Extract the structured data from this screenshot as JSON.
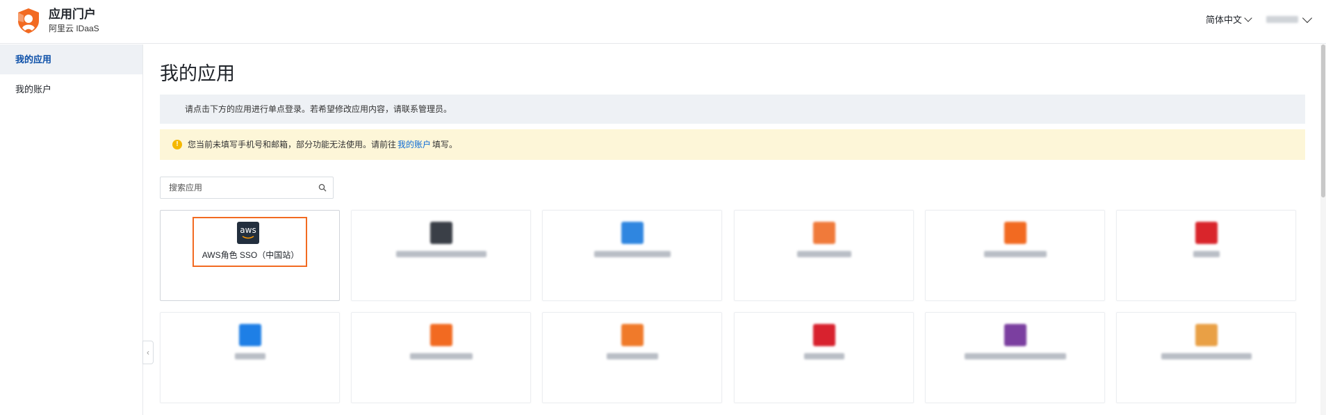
{
  "header": {
    "title": "应用门户",
    "subtitle": "阿里云 IDaaS",
    "language": "简体中文",
    "user_name": ""
  },
  "sidebar": {
    "items": [
      {
        "label": "我的应用",
        "active": true
      },
      {
        "label": "我的账户",
        "active": false
      }
    ]
  },
  "main": {
    "title": "我的应用",
    "notice": "请点击下方的应用进行单点登录。若希望修改应用内容，请联系管理员。",
    "warning": {
      "before": "您当前未填写手机号和邮箱，部分功能无法使用。请前往",
      "link": "我的账户",
      "after": "填写。"
    },
    "search": {
      "placeholder": "搜索应用",
      "value": ""
    },
    "apps": [
      {
        "name": "AWS角色 SSO（中国站）",
        "icon": "aws-icon",
        "blurred": false
      },
      {
        "name": "",
        "icon": "app-icon",
        "color": "#3a3f47",
        "blurred": true
      },
      {
        "name": "",
        "icon": "app-icon",
        "color": "#2f86e0",
        "blurred": true
      },
      {
        "name": "",
        "icon": "app-icon",
        "color": "#f07a3a",
        "blurred": true
      },
      {
        "name": "",
        "icon": "app-icon",
        "color": "#f26a21",
        "blurred": true
      },
      {
        "name": "",
        "icon": "app-icon",
        "color": "#d9252b",
        "blurred": true
      },
      {
        "name": "",
        "icon": "app-icon",
        "color": "#1e7fe6",
        "blurred": true
      },
      {
        "name": "",
        "icon": "app-icon",
        "color": "#f26a21",
        "blurred": true
      },
      {
        "name": "",
        "icon": "app-icon",
        "color": "#f07a2a",
        "blurred": true
      },
      {
        "name": "",
        "icon": "app-icon",
        "color": "#d8222e",
        "blurred": true
      },
      {
        "name": "",
        "icon": "app-icon",
        "color": "#7b3fa0",
        "blurred": true
      },
      {
        "name": "",
        "icon": "app-icon",
        "color": "#e9a045",
        "blurred": true
      }
    ]
  },
  "colors": {
    "accent": "#0b4fa8",
    "highlight": "#f26a21",
    "warning_bg": "#fdf6d8",
    "notice_bg": "#eef1f5"
  }
}
